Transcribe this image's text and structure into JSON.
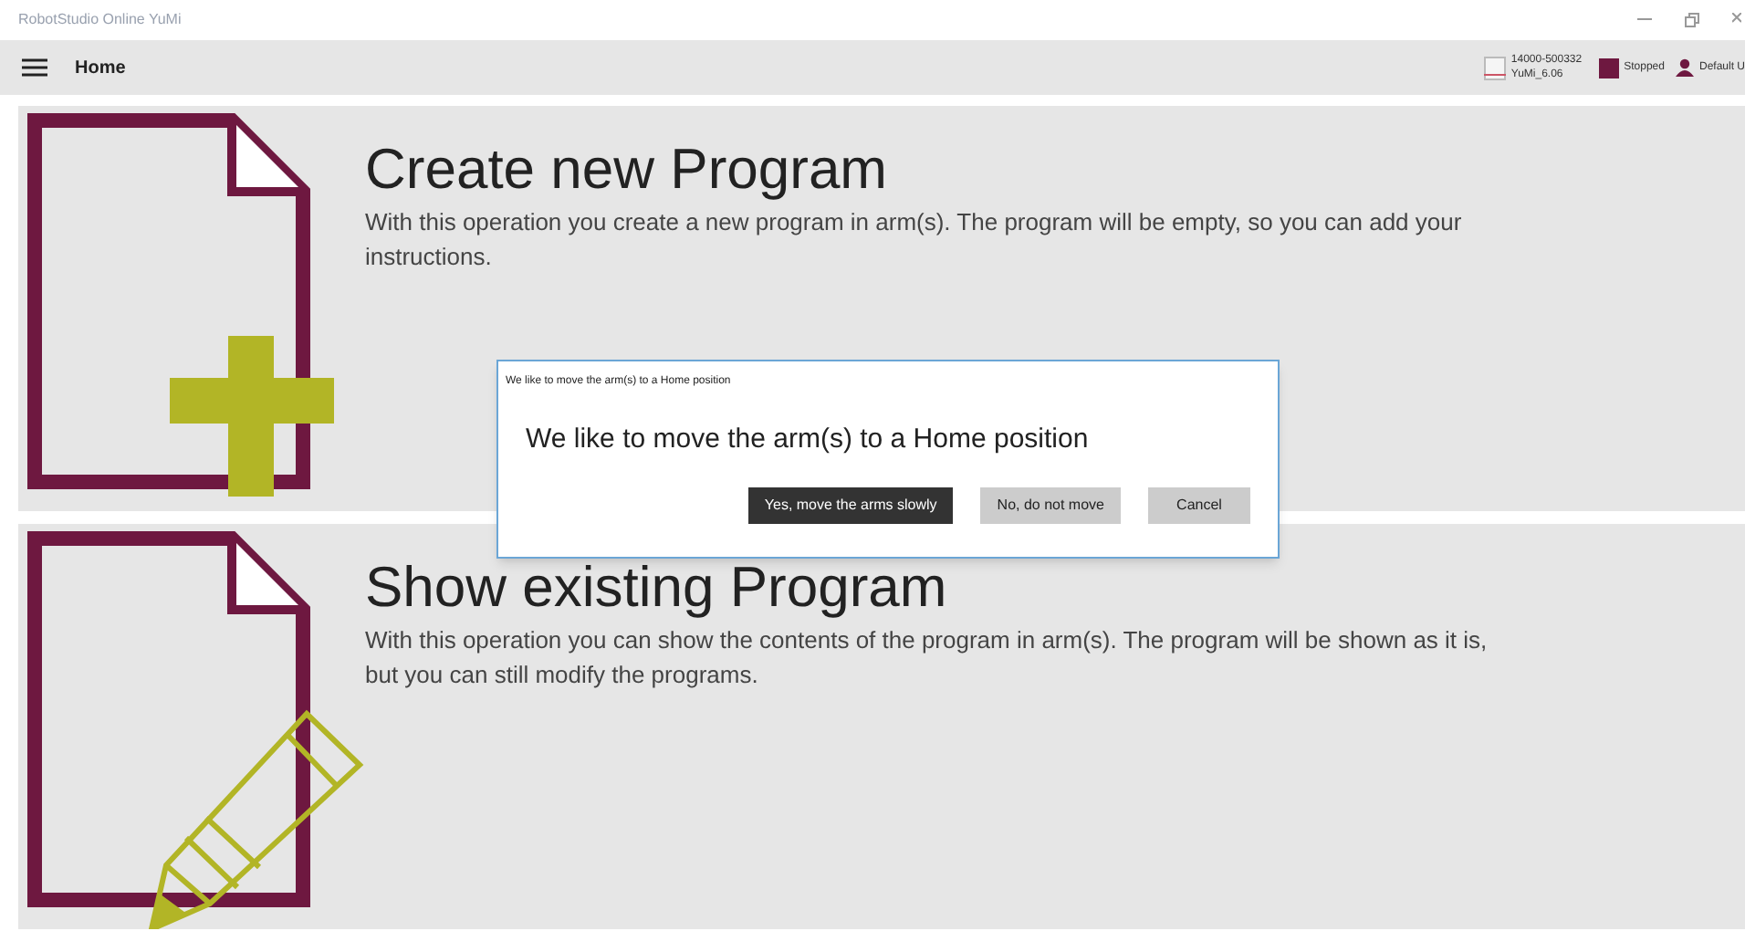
{
  "window": {
    "title": "RobotStudio Online YuMi"
  },
  "header": {
    "title": "Home"
  },
  "status": {
    "controller_id": "14000-500332",
    "controller_name": "YuMi_6.06",
    "state": "Stopped",
    "user": "Default U"
  },
  "cards": [
    {
      "kind": "create",
      "title": "Create new Program",
      "description": "With this operation you create a new program in arm(s). The program will be empty, so you can add your instructions."
    },
    {
      "kind": "show",
      "title": "Show existing Program",
      "description": "With this operation you can show the contents of the program in arm(s). The program will be shown as it is, but you can still modify the programs."
    }
  ],
  "dialog": {
    "caption": "We like to move the arm(s) to a Home position",
    "message": "We like to move the arm(s) to a Home position",
    "buttons": [
      {
        "label": "Yes, move the arms slowly",
        "primary": true
      },
      {
        "label": "No, do not move",
        "primary": false
      },
      {
        "label": "Cancel",
        "primary": false
      }
    ]
  }
}
